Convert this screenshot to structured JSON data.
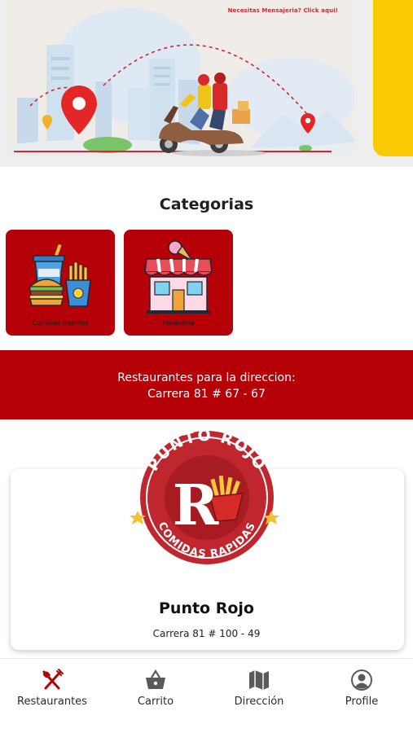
{
  "banner": {
    "link_text": "Necesitas Mensajeria? Click aqui!",
    "colors": {
      "accent": "#d7262b",
      "next_banner": "#f9c903"
    }
  },
  "categories": {
    "title": "Categorias",
    "items": [
      {
        "label": "Comidas Rapidas",
        "icon": "fast-food-icon"
      },
      {
        "label": "Heladeria",
        "icon": "ice-cream-shop-icon"
      }
    ]
  },
  "address": {
    "line1": "Restaurantes para la direccion:",
    "line2": "Carrera 81 # 67 - 67"
  },
  "restaurants": [
    {
      "name": "Punto Rojo",
      "address": "Carrera 81 # 100 - 49",
      "logo_top": "PUNTO ROJO",
      "logo_bottom": "COMIDAS RAPIDAS",
      "logo_letter": "R"
    }
  ],
  "nav": {
    "items": [
      {
        "label": "Restaurantes",
        "icon": "fork-knife-icon",
        "active": true
      },
      {
        "label": "Carrito",
        "icon": "basket-icon",
        "active": false
      },
      {
        "label": "Dirección",
        "icon": "map-icon",
        "active": false
      },
      {
        "label": "Profile",
        "icon": "profile-icon",
        "active": false
      }
    ]
  },
  "theme": {
    "primary": "#b50007",
    "active_icon": "#b50007",
    "inactive_icon": "#5a5a5a"
  }
}
